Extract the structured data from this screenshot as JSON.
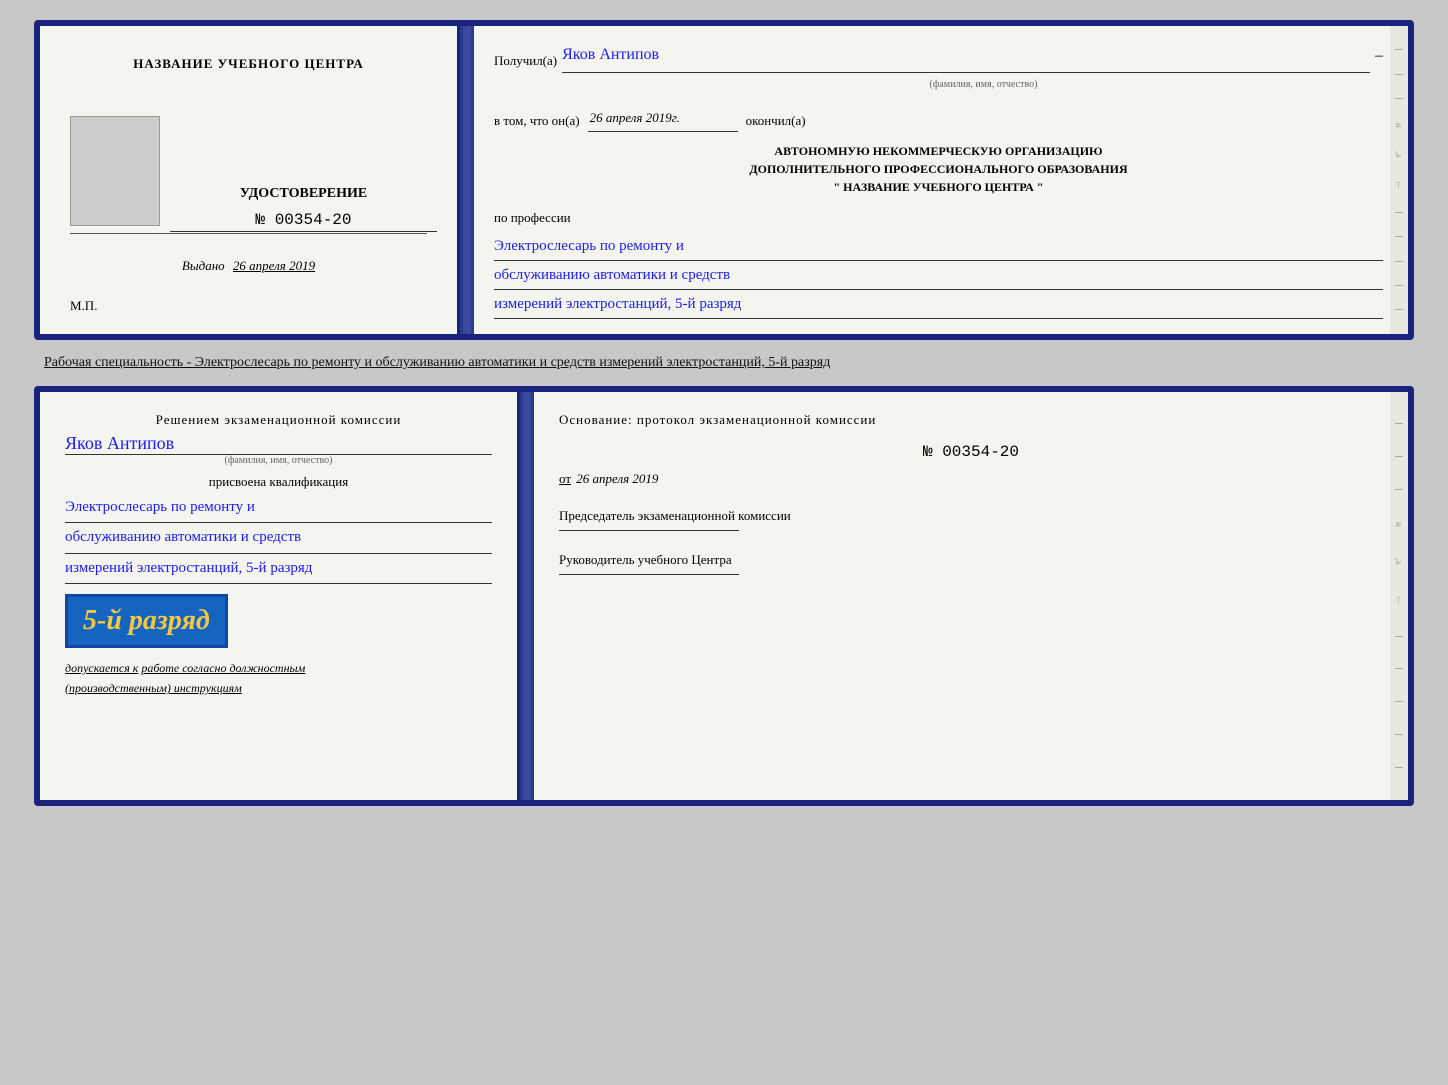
{
  "top_booklet": {
    "left": {
      "center_title": "НАЗВАНИЕ УЧЕБНОГО ЦЕНТРА",
      "cert_type": "УДОСТОВЕРЕНИЕ",
      "cert_num": "№ 00354-20",
      "issued_label": "Выдано",
      "issued_date": "26 апреля 2019",
      "mp_label": "М.П."
    },
    "right": {
      "recipient_label": "Получил(а)",
      "recipient_name": "Яков Антипов",
      "recipient_sub": "(фамилия, имя, отчество)",
      "date_label": "в том, что он(а)",
      "date_value": "26 апреля 2019г.",
      "date_suffix": "окончил(а)",
      "org_line1": "АВТОНОМНУЮ НЕКОММЕРЧЕСКУЮ ОРГАНИЗАЦИЮ",
      "org_line2": "ДОПОЛНИТЕЛЬНОГО ПРОФЕССИОНАЛЬНОГО ОБРАЗОВАНИЯ",
      "org_line3": "\"  НАЗВАНИЕ УЧЕБНОГО ЦЕНТРА  \"",
      "profession_label": "по профессии",
      "profession_line1": "Электрослесарь по ремонту и",
      "profession_line2": "обслуживанию автоматики и средств",
      "profession_line3": "измерений электростанций, 5-й разряд"
    }
  },
  "description": "Рабочая специальность - Электрослесарь по ремонту и обслуживанию автоматики и средств\nизмерений электростанций, 5-й разряд",
  "bottom_booklet": {
    "left": {
      "decision_title": "Решением экзаменационной комиссии",
      "person_name": "Яков Антипов",
      "name_sub": "(фамилия, имя, отчество)",
      "qualification_label": "присвоена квалификация",
      "qualification_line1": "Электрослесарь по ремонту и",
      "qualification_line2": "обслуживанию автоматики и средств",
      "qualification_line3": "измерений электростанций, 5-й разряд",
      "rank_badge": "5-й разряд",
      "допускается_prefix": "допускается к",
      "допускается_text": "работе согласно должностным",
      "допускается_text2": "(производственным) инструкциям"
    },
    "right": {
      "basis_title": "Основание: протокол экзаменационной комиссии",
      "protocol_num": "№ 00354-20",
      "date_prefix": "от",
      "date_value": "26 апреля 2019",
      "chairman_title": "Председатель экзаменационной\nкомиссии",
      "director_title": "Руководитель учебного\nЦентра"
    }
  }
}
